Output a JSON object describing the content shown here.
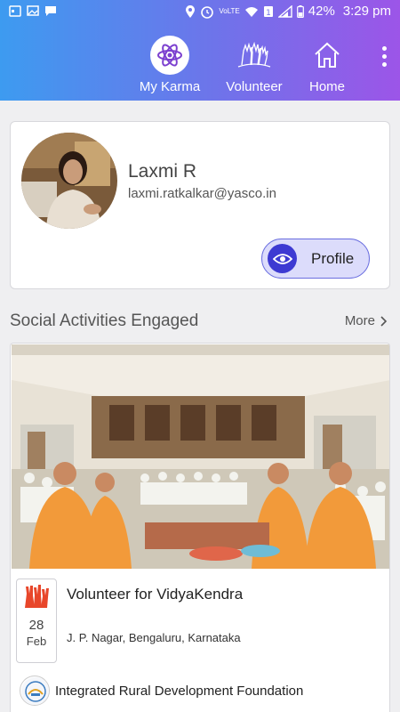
{
  "status_bar": {
    "battery": "42%",
    "time": "3:29 pm",
    "network_label": "VoLTE"
  },
  "nav": {
    "items": [
      {
        "label": "My Karma",
        "icon": "atom-icon",
        "active": true
      },
      {
        "label": "Volunteer",
        "icon": "volunteer-hands-icon",
        "active": false
      },
      {
        "label": "Home",
        "icon": "home-icon",
        "active": false
      }
    ]
  },
  "profile": {
    "name": "Laxmi R",
    "email": "laxmi.ratkalkar@yasco.in",
    "button_label": "Profile"
  },
  "section": {
    "title": "Social Activities Engaged",
    "more_label": "More"
  },
  "activity": {
    "title": "Volunteer for VidyaKendra",
    "day": "28",
    "month": "Feb",
    "location": "J. P. Nagar, Bengaluru, Karnataka",
    "organization": "Integrated Rural Development Foundation"
  },
  "colors": {
    "header_start": "#3d9bf0",
    "header_end": "#9c55e8",
    "accent": "#3d3ad2",
    "profile_button_bg": "#dcdcfb"
  }
}
